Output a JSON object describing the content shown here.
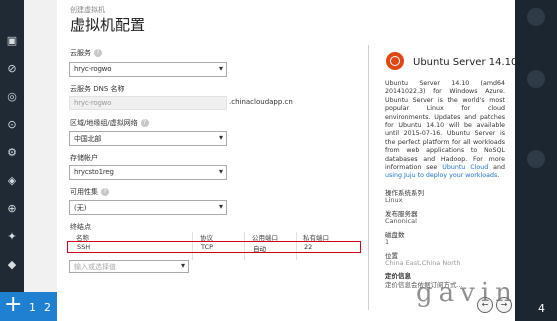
{
  "wizard": {
    "breadcrumb": "创建虚拟机",
    "title": "虚拟机配置",
    "step_numbers": [
      "1",
      "2"
    ],
    "final_step": "4"
  },
  "form": {
    "cloud_service": {
      "label": "云服务",
      "value": "hryc-rogwo"
    },
    "dns_name": {
      "label": "云服务 DNS 名称",
      "value": "hryc-rogwo",
      "suffix": ".chinacloudapp.cn"
    },
    "region": {
      "label": "区域/地缘组/虚拟网络",
      "value": "中国北部"
    },
    "storage": {
      "label": "存储帐户",
      "value": "hrycsto1reg"
    },
    "availability_set": {
      "label": "可用性集",
      "value": "(无)"
    },
    "endpoints": {
      "label": "终结点",
      "columns": [
        "名称",
        "协议",
        "公用端口",
        "私有端口"
      ],
      "rows": [
        {
          "name": "SSH",
          "protocol": "TCP",
          "public_port": "自动",
          "private_port": "22"
        }
      ],
      "new_placeholder": "输入或选择值"
    }
  },
  "info_panel": {
    "title": "Ubuntu Server 14.10",
    "description_lines": [
      "Ubuntu Server 14.10 (amd64 20141022.3) for Windows Azure. Ubuntu Server is the world's most popular Linux for cloud environments. Updates and patches for Ubuntu 14.10 will be available until 2015-07-16. Ubuntu Server is the perfect platform for all workloads from web applications to NoSQL databases and Hadoop. For more information see ",
      "Ubuntu Cloud",
      " and ",
      "using Juju to deploy your workloads",
      "."
    ],
    "details": [
      {
        "key": "操作系统系列",
        "value": "Linux"
      },
      {
        "key": "发布服务器",
        "value": "Canonical"
      },
      {
        "key": "磁盘数",
        "value": "1"
      },
      {
        "key": "位置",
        "value": "China East,China North"
      }
    ],
    "pricing_title": "定价信息",
    "pricing_text": "定价信息会依据订阅方式..."
  },
  "watermark": "gavin",
  "icons": [
    "question-icon",
    "chevron-down-icon",
    "ubuntu-logo",
    "back-arrow-icon",
    "next-arrow-icon",
    "plus-icon"
  ],
  "colors": {
    "accent": "#1f7fd1",
    "sidebar": "#1f2a35",
    "highlight": "#d0021b",
    "ubuntu": "#dd4814"
  }
}
